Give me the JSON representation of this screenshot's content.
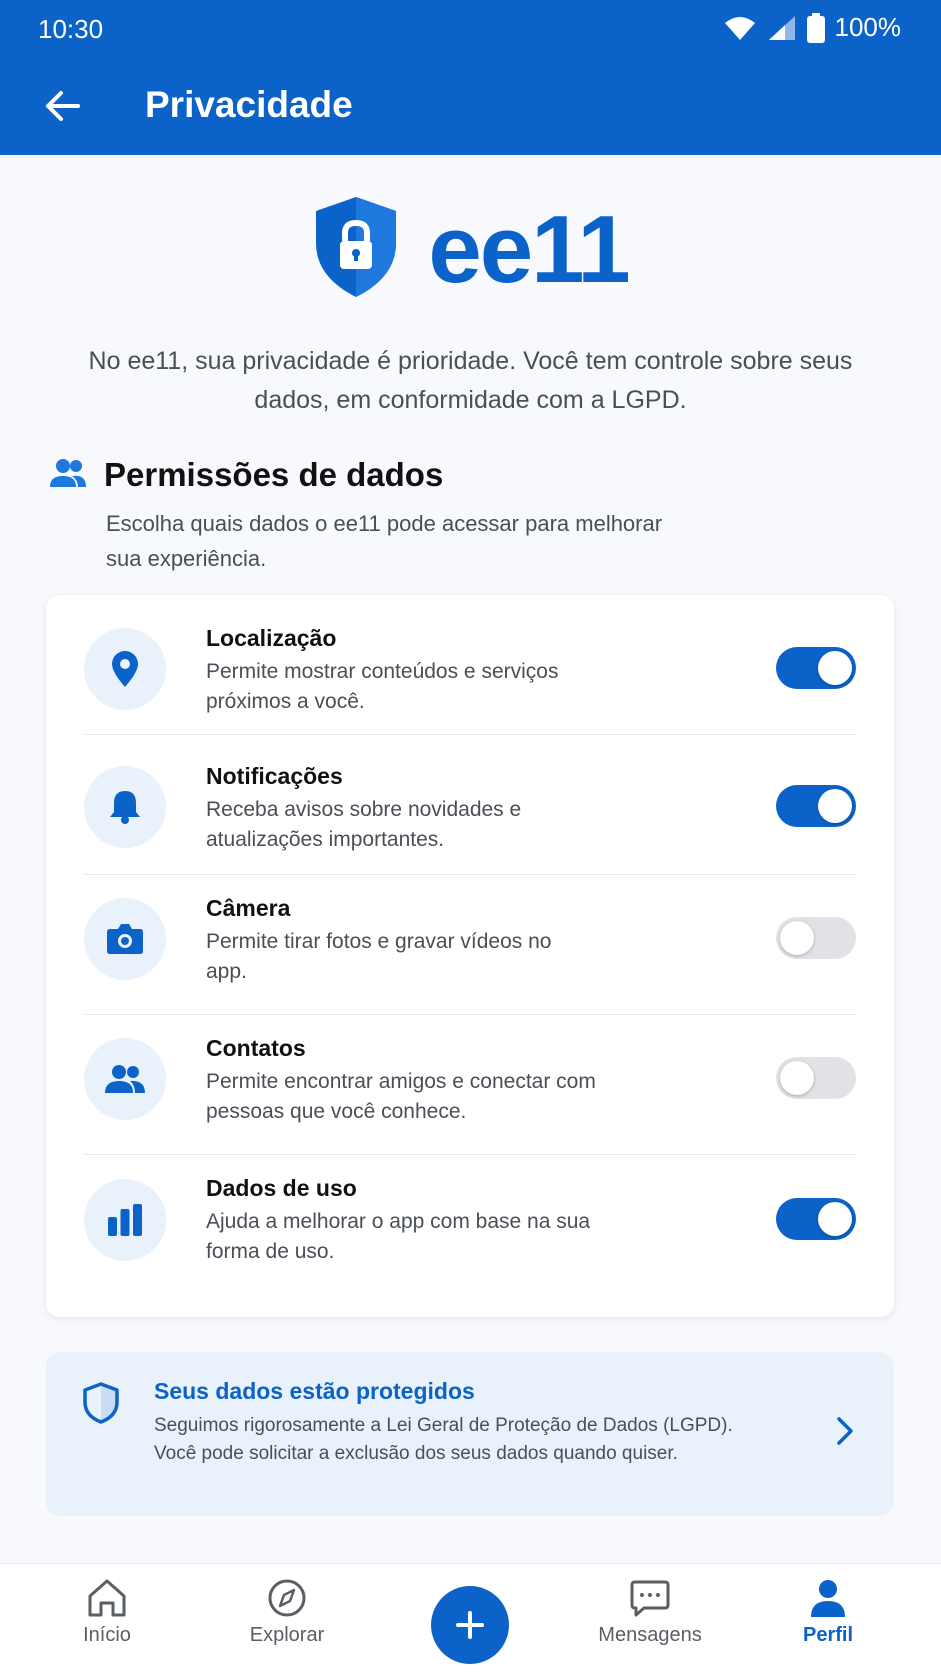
{
  "status_bar": {
    "time": "10:30",
    "battery": "100%"
  },
  "header": {
    "title": "Privacidade"
  },
  "brand": {
    "name": "ee11"
  },
  "intro": "No ee11, sua privacidade é prioridade. Você tem controle sobre seus dados, em conformidade com a LGPD.",
  "permissions": {
    "title": "Permissões de dados",
    "subtitle": "Escolha quais dados o ee11 pode acessar para melhorar sua experiência.",
    "items": [
      {
        "title": "Localização",
        "description": "Permite mostrar conteúdos e serviços próximos a você.",
        "enabled": true,
        "icon": "location-pin-icon"
      },
      {
        "title": "Notificações",
        "description": "Receba avisos sobre novidades e atualizações importantes.",
        "enabled": true,
        "icon": "bell-icon"
      },
      {
        "title": "Câmera",
        "description": "Permite tirar fotos e gravar vídeos no app.",
        "enabled": false,
        "icon": "camera-icon"
      },
      {
        "title": "Contatos",
        "description": "Permite encontrar amigos e conectar com pessoas que você conhece.",
        "enabled": false,
        "icon": "people-icon"
      },
      {
        "title": "Dados de uso",
        "description": "Ajuda a melhorar o app com base na sua forma de uso.",
        "enabled": true,
        "icon": "bar-chart-icon"
      }
    ]
  },
  "protection": {
    "title": "Seus dados estão protegidos",
    "text": "Seguimos rigorosamente a Lei Geral de Proteção de Dados (LGPD). Você pode solicitar a exclusão dos seus dados quando quiser."
  },
  "nav": {
    "items": [
      {
        "label": "Início",
        "icon": "home-icon",
        "active": false
      },
      {
        "label": "Explorar",
        "icon": "compass-icon",
        "active": false
      },
      {
        "label": "Mensagens",
        "icon": "chat-icon",
        "active": false
      },
      {
        "label": "Perfil",
        "icon": "person-icon",
        "active": true
      }
    ]
  },
  "colors": {
    "primary": "#0b63c9",
    "icon_bg": "#e9f1fb",
    "toggle_off": "#e0e2e6"
  }
}
